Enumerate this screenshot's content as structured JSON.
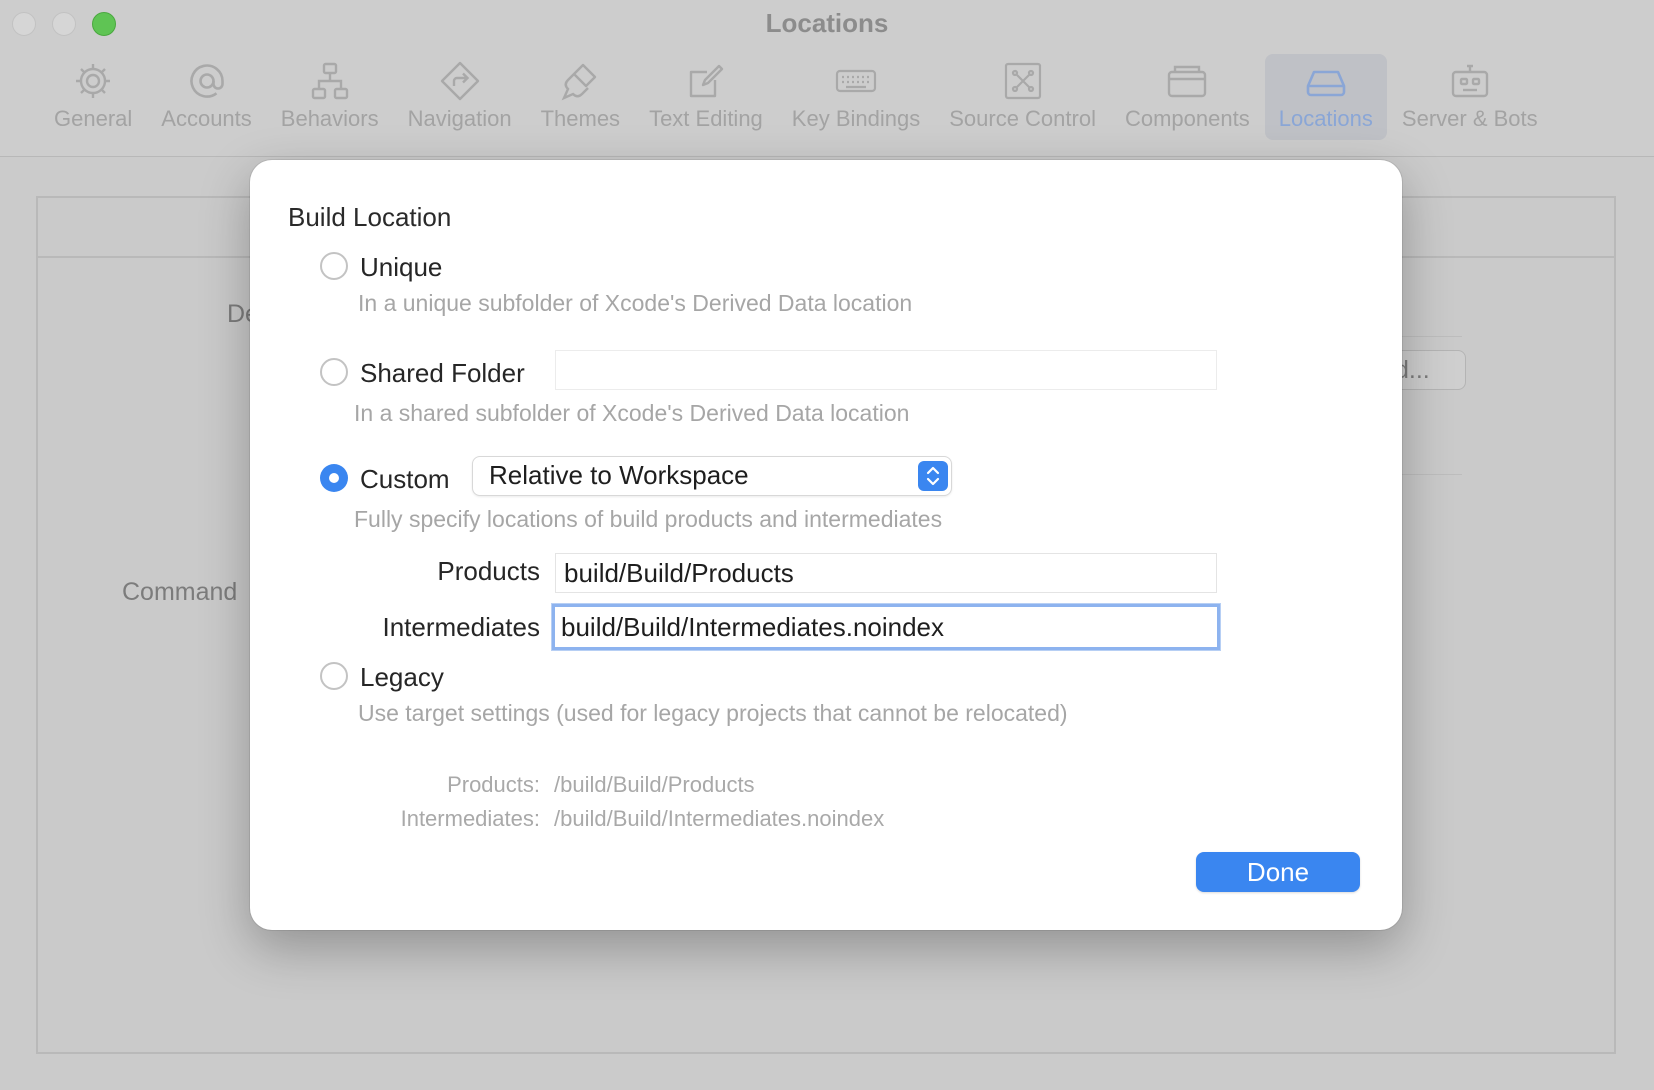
{
  "window": {
    "title": "Locations"
  },
  "toolbar": {
    "items": [
      {
        "label": "General",
        "icon": "gear-icon"
      },
      {
        "label": "Accounts",
        "icon": "at-icon"
      },
      {
        "label": "Behaviors",
        "icon": "hierarchy-icon"
      },
      {
        "label": "Navigation",
        "icon": "navigation-diamond-icon"
      },
      {
        "label": "Themes",
        "icon": "brush-icon"
      },
      {
        "label": "Text Editing",
        "icon": "pencil-square-icon"
      },
      {
        "label": "Key Bindings",
        "icon": "keyboard-icon"
      },
      {
        "label": "Source Control",
        "icon": "source-control-icon"
      },
      {
        "label": "Components",
        "icon": "components-box-icon"
      },
      {
        "label": "Locations",
        "icon": "drive-icon"
      },
      {
        "label": "Server & Bots",
        "icon": "robot-icon"
      }
    ],
    "active": "Locations"
  },
  "background": {
    "label_de": "De",
    "label_command": "Command",
    "button_partial": "d..."
  },
  "sheet": {
    "section_title": "Build Location",
    "options": {
      "unique": {
        "label": "Unique",
        "description": "In a unique subfolder of Xcode's Derived Data location",
        "selected": false
      },
      "shared": {
        "label": "Shared Folder",
        "field_value": "",
        "description": "In a shared subfolder of Xcode's Derived Data location",
        "selected": false
      },
      "custom": {
        "label": "Custom",
        "popup_value": "Relative to Workspace",
        "description": "Fully specify locations of build products and intermediates",
        "selected": true,
        "products_label": "Products",
        "products_value": "build/Build/Products",
        "intermediates_label": "Intermediates",
        "intermediates_value": "build/Build/Intermediates.noindex"
      },
      "legacy": {
        "label": "Legacy",
        "description": "Use target settings (used for legacy projects that cannot be relocated)",
        "selected": false
      }
    },
    "resolved": {
      "products_label": "Products:",
      "products_value": "/build/Build/Products",
      "intermediates_label": "Intermediates:",
      "intermediates_value": "/build/Build/Intermediates.noindex"
    },
    "done_label": "Done"
  },
  "colors": {
    "accent": "#3a86f0",
    "focus_ring": "#8db3ef",
    "secondary_text": "#a6a6a6"
  }
}
